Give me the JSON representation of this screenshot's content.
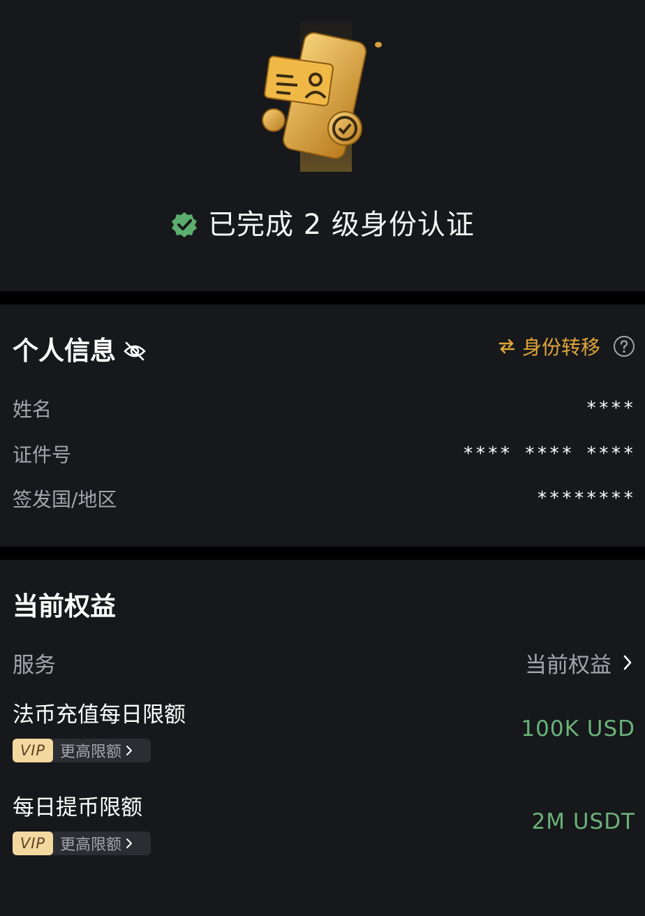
{
  "hero": {
    "status_text": "已完成 2 级身份认证"
  },
  "personal_info": {
    "title": "个人信息",
    "transfer_label": "身份转移",
    "fields": [
      {
        "label": "姓名",
        "value": "****"
      },
      {
        "label": "证件号",
        "value": "**** **** ****"
      },
      {
        "label": "签发国/地区",
        "value": "********"
      }
    ]
  },
  "benefits": {
    "title": "当前权益",
    "service_label": "服务",
    "current_label": "当前权益",
    "limits": [
      {
        "name": "法币充值每日限额",
        "vip_badge": "VIP",
        "vip_link": "更高限额",
        "value": "100K USD"
      },
      {
        "name": "每日提币限额",
        "vip_badge": "VIP",
        "vip_link": "更高限额",
        "value": "2M USDT"
      }
    ]
  },
  "colors": {
    "background": "#16181b",
    "divider": "#000000",
    "accent_gold": "#e0a53a",
    "success_green": "#6bb27a",
    "verified_badge": "#5cae6e"
  },
  "icons": {
    "status": "verified-badge-icon",
    "privacy": "eye-off-icon",
    "transfer": "swap-arrows-icon",
    "help": "question-circle-icon",
    "chevron": "chevron-right-icon"
  }
}
